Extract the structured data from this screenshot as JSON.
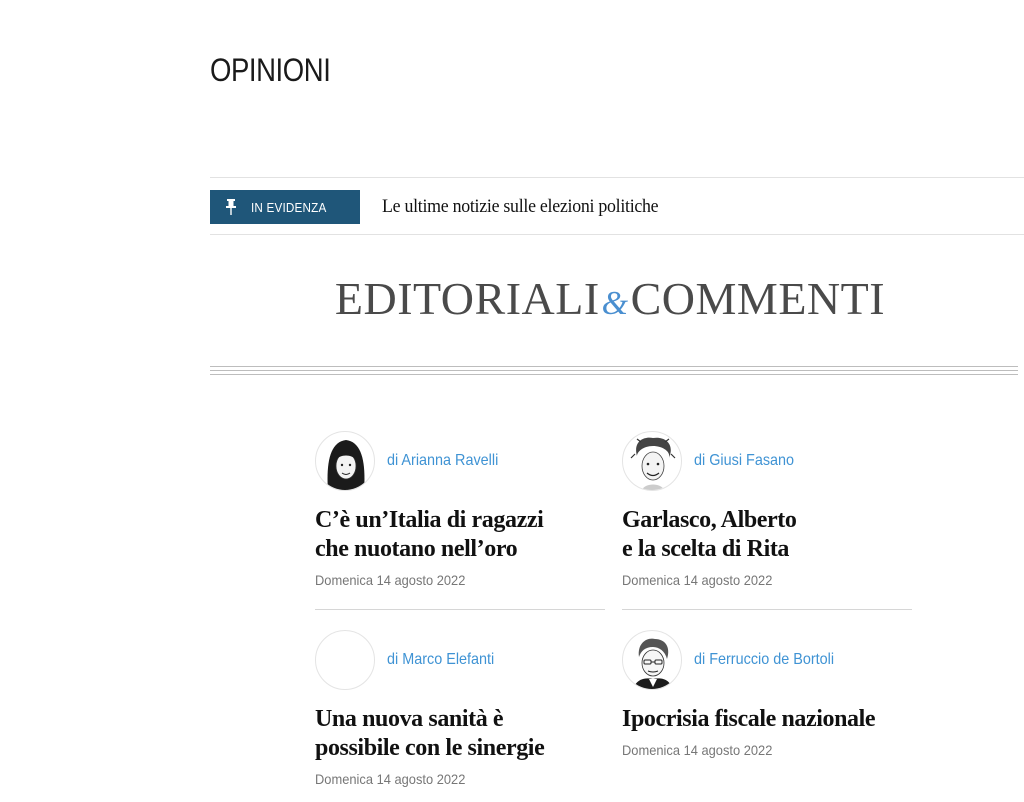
{
  "section": {
    "title": "OPINIONI"
  },
  "evidenza": {
    "badge_icon": "pin-icon",
    "badge_label": "IN EVIDENZA",
    "link_text": "Le ultime notizie sulle elezioni politiche"
  },
  "banner": {
    "part1": "EDITORIALI",
    "amp": "&",
    "part2": "COMMENTI"
  },
  "articles": [
    {
      "author": "di Arianna Ravelli",
      "headline": "C’è un’Italia di ragazzi\nche nuotano nell’oro",
      "date": "Domenica 14 agosto 2022",
      "avatar_icon": "author-portrait-icon"
    },
    {
      "author": "di Giusi Fasano",
      "headline": "Garlasco, Alberto\ne la scelta di Rita",
      "date": "Domenica 14 agosto 2022",
      "avatar_icon": "author-portrait-icon"
    },
    {
      "author": "di Marco Elefanti",
      "headline": "Una nuova sanità è\npossibile con le sinergie",
      "date": "Domenica 14 agosto 2022",
      "avatar_icon": "empty-avatar-icon"
    },
    {
      "author": "di Ferruccio de Bortoli",
      "headline": "Ipocrisia fiscale nazionale",
      "date": "Domenica 14 agosto 2022",
      "avatar_icon": "author-portrait-icon"
    }
  ],
  "colors": {
    "badge_background": "#1f5679",
    "author_link": "#3f93d4",
    "banner_text": "#4a4a4a",
    "ampersand": "#4a8fd0"
  }
}
